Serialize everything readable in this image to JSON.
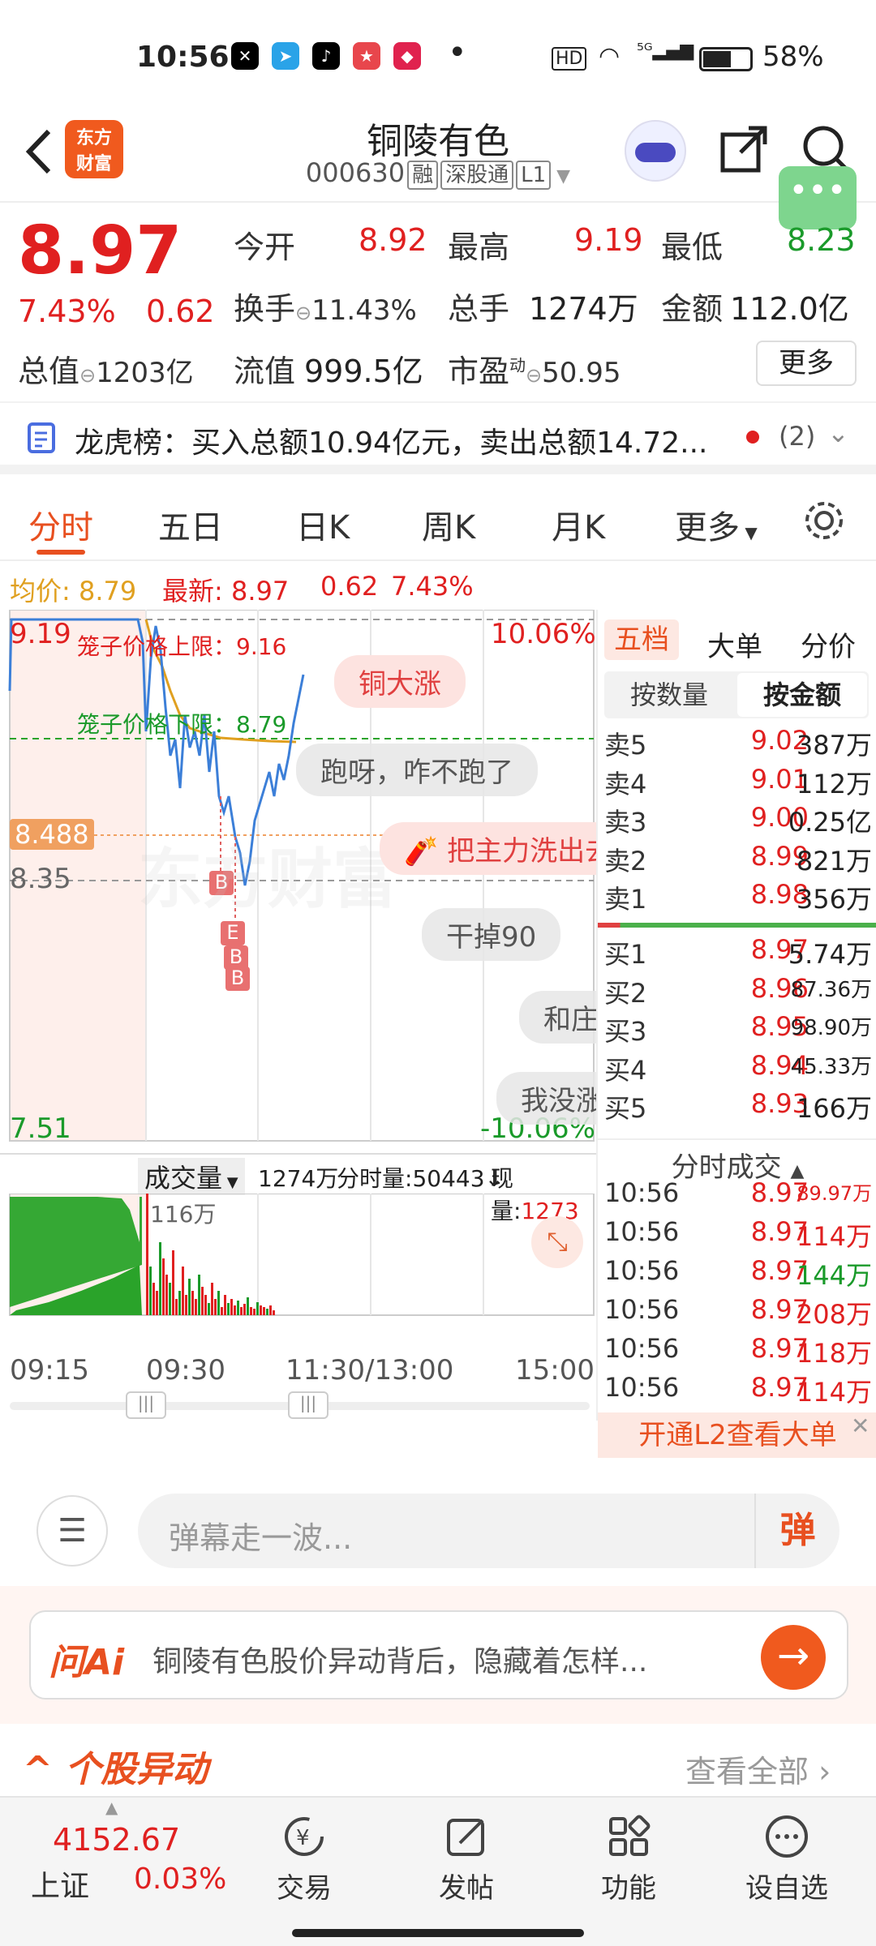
{
  "status": {
    "time": "10:56",
    "battery": "58%",
    "network": "5G",
    "hd": "HD"
  },
  "header": {
    "name": "铜陵有色",
    "code": "000630",
    "tags": [
      "融",
      "深股通",
      "L1"
    ],
    "app": "东方\n财富"
  },
  "quote": {
    "price": "8.97",
    "pct": "7.43%",
    "chg": "0.62",
    "open_label": "今开",
    "open": "8.92",
    "high_label": "最高",
    "high": "9.19",
    "low_label": "最低",
    "low": "8.23",
    "turnover_label": "换手",
    "turnover": "11.43%",
    "vol_label": "总手",
    "vol": "1274万",
    "amt_label": "金额",
    "amt": "112.0亿",
    "mcap_label": "总值",
    "mcap": "1203亿",
    "float_label": "流值",
    "float": "999.5亿",
    "pe_label": "市盈",
    "pe_sup": "动",
    "pe": "50.95",
    "more": "更多"
  },
  "longhu": {
    "label": "龙虎榜：",
    "text": "买入总额10.94亿元，卖出总额14.72...",
    "count": "(2)"
  },
  "tabs": [
    "分时",
    "五日",
    "日K",
    "周K",
    "月K",
    "更多"
  ],
  "infoline": {
    "avg_label": "均价:",
    "avg": "8.79",
    "last_label": "最新:",
    "last": "8.97",
    "chg": "0.62",
    "pct": "7.43%"
  },
  "chart": {
    "y_top": "9.19",
    "y_mid": "8.35",
    "y_bot": "7.51",
    "pct_top": "10.06%",
    "pct_bot": "-10.06%",
    "upper_limit": "笼子价格上限：9.16",
    "lower_limit": "笼子价格下限：8.79",
    "marker": "8.488",
    "volume_label": "成交量",
    "volume_total": "1274万",
    "tick_vol_label": "分时量:",
    "tick_vol": "50443",
    "now_vol_label": "现量:",
    "now_vol": "1273",
    "vol_max": "116万",
    "times": [
      "09:15",
      "09:30",
      "11:30/13:00",
      "15:00"
    ],
    "bs_markers": [
      "B",
      "E",
      "B",
      "B"
    ],
    "bs_markers_2": [
      "B",
      "B"
    ]
  },
  "danmaku": [
    "铜大涨",
    "跑呀，咋不跑了",
    "把主力洗出去",
    "干掉90",
    "和庄",
    "我没涨"
  ],
  "orderbook": {
    "tabs": [
      "五档",
      "大单",
      "分价"
    ],
    "subtabs": [
      "按数量",
      "按金额"
    ],
    "sells": [
      {
        "l": "卖5",
        "p": "9.02",
        "v": "387万"
      },
      {
        "l": "卖4",
        "p": "9.01",
        "v": "112万"
      },
      {
        "l": "卖3",
        "p": "9.00",
        "v": "0.25亿"
      },
      {
        "l": "卖2",
        "p": "8.99",
        "v": "821万"
      },
      {
        "l": "卖1",
        "p": "8.98",
        "v": "356万"
      }
    ],
    "buys": [
      {
        "l": "买1",
        "p": "8.97",
        "v": "5.74万"
      },
      {
        "l": "买2",
        "p": "8.96",
        "v": "87.36万"
      },
      {
        "l": "买3",
        "p": "8.95",
        "v": "98.90万"
      },
      {
        "l": "买4",
        "p": "8.94",
        "v": "45.33万"
      },
      {
        "l": "买5",
        "p": "8.93",
        "v": "166万"
      }
    ],
    "ticks_title": "分时成交",
    "ticks": [
      {
        "t": "10:56",
        "p": "8.97",
        "v": "89.97万"
      },
      {
        "t": "10:56",
        "p": "8.97",
        "v": "114万"
      },
      {
        "t": "10:56",
        "p": "8.97",
        "v": "144万"
      },
      {
        "t": "10:56",
        "p": "8.97",
        "v": "208万"
      },
      {
        "t": "10:56",
        "p": "8.97",
        "v": "118万"
      },
      {
        "t": "10:56",
        "p": "8.97",
        "v": "114万"
      }
    ],
    "l2": "开通L2查看大单"
  },
  "comment": {
    "placeholder": "弹幕走一波...",
    "btn": "弹"
  },
  "ai": {
    "logo": "问Ai",
    "text": "铜陵有色股价异动背后，隐藏着怎样..."
  },
  "anomaly": {
    "title": "个股异动",
    "more": "查看全部"
  },
  "bottom": {
    "index_value": "4152.67",
    "index_name": "上证",
    "index_pct": "0.03%",
    "items": [
      "交易",
      "发帖",
      "功能",
      "设自选"
    ]
  },
  "colors": {
    "red": "#e02020",
    "green": "#1a9a2a",
    "orange": "#f05a1e"
  }
}
